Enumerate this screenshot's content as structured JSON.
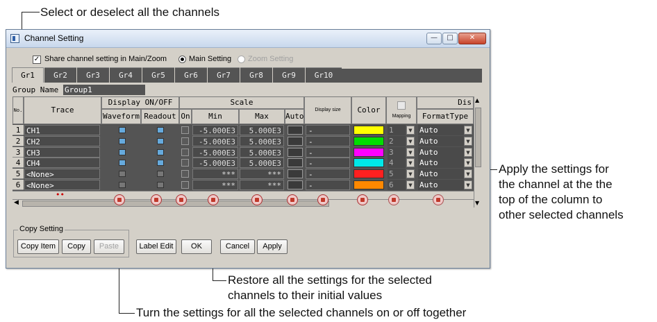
{
  "callouts": {
    "select_all": "Select or deselect all the channels",
    "apply_line1": "Apply the settings for",
    "apply_line2": "the channel at the the",
    "apply_line3": "top of the column to",
    "apply_line4": "other selected channels",
    "restore_line1": "Restore all the settings for the selected",
    "restore_line2": "channels to their initial values",
    "toggle": "Turn the settings for all the selected channels on or off together"
  },
  "window": {
    "title": "Channel Setting",
    "share_label": "Share channel setting in Main/Zoom",
    "share_checked": true,
    "main_setting": "Main Setting",
    "zoom_setting": "Zoom Setting",
    "tabs": [
      "Gr1",
      "Gr2",
      "Gr3",
      "Gr4",
      "Gr5",
      "Gr6",
      "Gr7",
      "Gr8",
      "Gr9",
      "Gr10"
    ],
    "active_tab": "Gr1",
    "group_name_label": "Group Name",
    "group_name_value": "Group1"
  },
  "table": {
    "headers": {
      "no": "No.",
      "trace": "Trace",
      "display": "Display ON/OFF",
      "waveform": "Waveform",
      "readout": "Readout",
      "scale": "Scale",
      "on": "On",
      "min": "Min",
      "max": "Max",
      "auto": "Auto",
      "display_size": "Display size",
      "color": "Color",
      "mapping": "Mapping",
      "dis": "Dis",
      "format_type": "FormatType"
    },
    "rows": [
      {
        "no": "1",
        "trace": "CH1",
        "min": "-5.000E3",
        "max": "5.000E3",
        "size": "-",
        "color": "#ffff00",
        "map": "1",
        "fmt": "Auto"
      },
      {
        "no": "2",
        "trace": "CH2",
        "min": "-5.000E3",
        "max": "5.000E3",
        "size": "-",
        "color": "#00dd00",
        "map": "2",
        "fmt": "Auto"
      },
      {
        "no": "3",
        "trace": "CH3",
        "min": "-5.000E3",
        "max": "5.000E3",
        "size": "-",
        "color": "#ff00ff",
        "map": "3",
        "fmt": "Auto"
      },
      {
        "no": "4",
        "trace": "CH4",
        "min": "-5.000E3",
        "max": "5.000E3",
        "size": "-",
        "color": "#00e8e8",
        "map": "4",
        "fmt": "Auto"
      },
      {
        "no": "5",
        "trace": "<None>",
        "min": "***",
        "max": "***",
        "size": "-",
        "color": "#ff2020",
        "map": "5",
        "fmt": "Auto"
      },
      {
        "no": "6",
        "trace": "<None>",
        "min": "***",
        "max": "***",
        "size": "-",
        "color": "#ff8800",
        "map": "6",
        "fmt": "Auto"
      }
    ],
    "marker": "••"
  },
  "footer": {
    "copy_group": "Copy Setting",
    "copy_item": "Copy Item",
    "copy": "Copy",
    "paste": "Paste",
    "label_edit": "Label Edit",
    "ok": "OK",
    "cancel": "Cancel",
    "apply": "Apply"
  }
}
